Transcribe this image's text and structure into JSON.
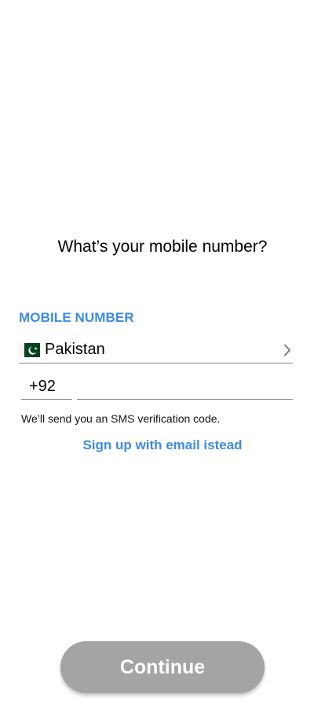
{
  "screen": {
    "title": "What’s your mobile number?"
  },
  "mobile": {
    "label": "MOBILE NUMBER",
    "country": {
      "flag_icon": "pakistan-flag-icon",
      "name": "Pakistan",
      "chevron_icon": "chevron-right-icon"
    },
    "dial_code": "+92",
    "phone_value": "",
    "phone_placeholder": ""
  },
  "hint": "We’ll send you an SMS verification code.",
  "email_link": "Sign up with email istead",
  "continue_label": "Continue",
  "colors": {
    "accent": "#3d8be6",
    "button_disabled": "#a4a4a4",
    "divider": "#8a8a8a",
    "flag_green": "#01411c"
  }
}
